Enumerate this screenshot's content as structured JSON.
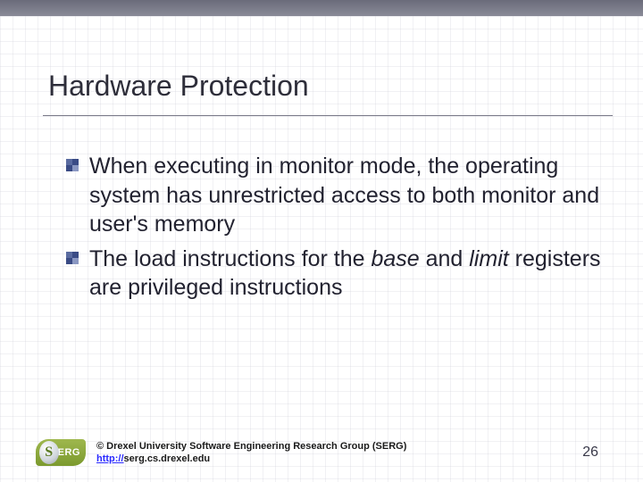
{
  "title": "Hardware Protection",
  "bullets": [
    {
      "runs": [
        {
          "t": "When executing in monitor mode, the operating system has unrestricted access to both monitor and user's memory"
        }
      ]
    },
    {
      "runs": [
        {
          "t": "The load instructions for the "
        },
        {
          "t": "base",
          "italic": true
        },
        {
          "t": " and "
        },
        {
          "t": "limit",
          "italic": true
        },
        {
          "t": " registers are privileged instructions"
        }
      ]
    }
  ],
  "footer": {
    "logo_text": "ERG",
    "logo_s": "S",
    "copyright": "© Drexel University Software Engineering Research Group (SERG)",
    "url_prefix": "http://",
    "url_rest": "serg.cs.drexel.edu"
  },
  "page_number": "26"
}
